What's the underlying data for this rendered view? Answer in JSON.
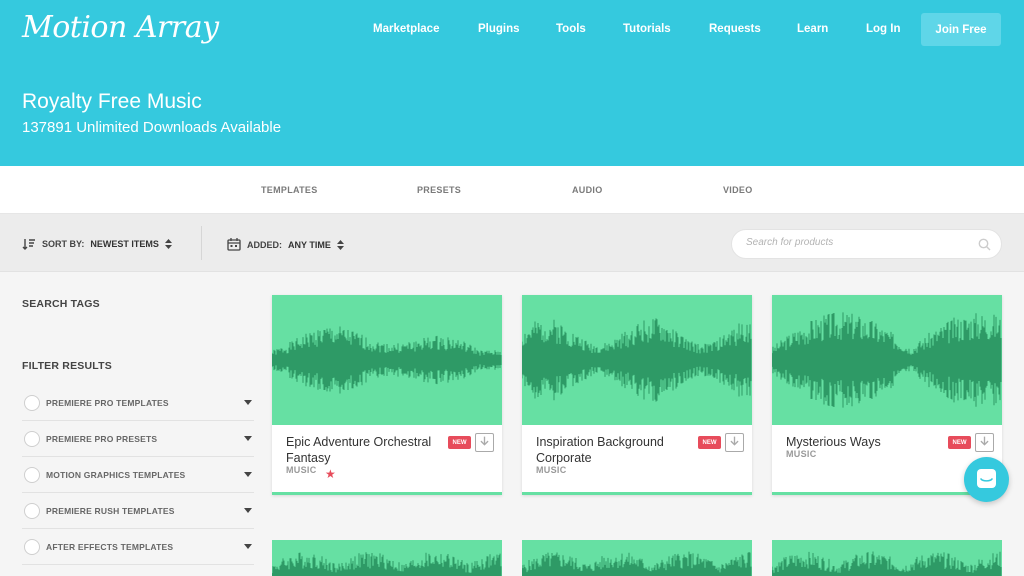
{
  "header": {
    "logo": "Motion Array",
    "nav": [
      "Marketplace",
      "Plugins",
      "Tools",
      "Tutorials",
      "Requests",
      "Learn",
      "Log In"
    ],
    "join": "Join Free",
    "title": "Royalty Free Music",
    "subtitle": "137891 Unlimited Downloads Available"
  },
  "categories": [
    "TEMPLATES",
    "PRESETS",
    "AUDIO",
    "VIDEO"
  ],
  "filterbar": {
    "sort_label": "SORT BY:",
    "sort_value": "NEWEST ITEMS",
    "added_label": "ADDED:",
    "added_value": "ANY TIME",
    "search_placeholder": "Search for products"
  },
  "sidebar": {
    "search_tags": "SEARCH TAGS",
    "filter_results": "FILTER RESULTS",
    "filters": [
      "PREMIERE PRO TEMPLATES",
      "PREMIERE PRO PRESETS",
      "MOTION GRAPHICS TEMPLATES",
      "PREMIERE RUSH TEMPLATES",
      "AFTER EFFECTS TEMPLATES"
    ]
  },
  "cards": [
    {
      "title": "Epic Adventure Orchestral Fantasy",
      "category": "MUSIC",
      "badge": "NEW",
      "favorite": true
    },
    {
      "title": "Inspiration Background Corporate",
      "category": "MUSIC",
      "badge": "NEW",
      "favorite": false
    },
    {
      "title": "Mysterious Ways",
      "category": "MUSIC",
      "badge": "NEW",
      "favorite": false
    }
  ],
  "colors": {
    "accent": "#35c9de",
    "wave_bg": "#66e0a3",
    "wave_fg": "#2e9a66",
    "badge": "#e74c5b"
  }
}
